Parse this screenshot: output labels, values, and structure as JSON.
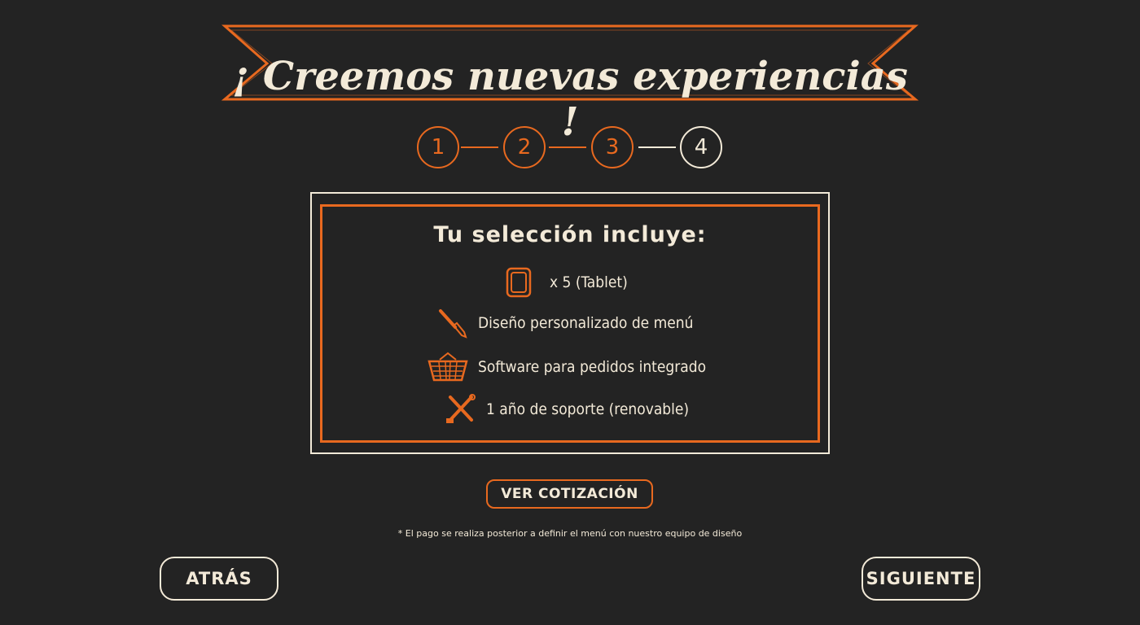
{
  "banner": {
    "title": "¡ Creemos nuevas experiencias !"
  },
  "stepper": {
    "steps": [
      {
        "label": "1",
        "state": "done"
      },
      {
        "label": "2",
        "state": "done"
      },
      {
        "label": "3",
        "state": "done"
      },
      {
        "label": "4",
        "state": "current"
      }
    ]
  },
  "selection": {
    "title": "Tu selección incluye:",
    "items": [
      {
        "icon": "tablet-icon",
        "label": "x 5 (Tablet)"
      },
      {
        "icon": "brush-icon",
        "label": "Diseño personalizado de menú"
      },
      {
        "icon": "basket-icon",
        "label": "Software para pedidos integrado"
      },
      {
        "icon": "tools-icon",
        "label": "1 año de soporte (renovable)"
      }
    ]
  },
  "actions": {
    "quote_label": "VER COTIZACIÓN",
    "footnote": "* El pago se realiza posterior a definir el menú con nuestro equipo de diseño",
    "back_label": "ATRÁS",
    "next_label": "SIGUIENTE"
  },
  "colors": {
    "background": "#232323",
    "accent": "#e8691f",
    "chalk": "#f3ead8"
  }
}
